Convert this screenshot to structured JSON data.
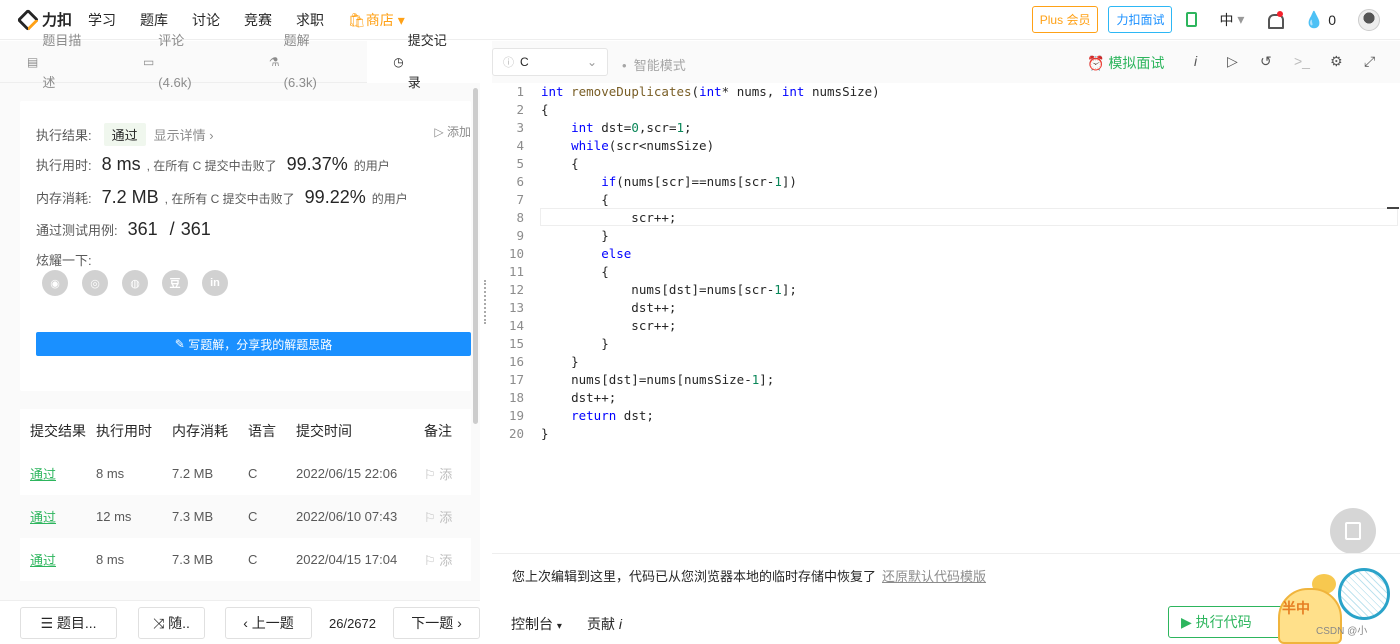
{
  "topnav": {
    "logo_text": "力扣",
    "items": [
      "学习",
      "题库",
      "讨论",
      "竞赛",
      "求职"
    ],
    "store": "商店",
    "plus": "Plus 会员",
    "interview": "力扣面试",
    "lang": "中",
    "points": "0"
  },
  "tabs": [
    {
      "label": "题目描述",
      "icon": "doc-icon"
    },
    {
      "label": "评论 (4.6k)",
      "icon": "comment-icon"
    },
    {
      "label": "题解 (6.3k)",
      "icon": "flask-icon"
    },
    {
      "label": "提交记录",
      "icon": "clock-icon"
    }
  ],
  "result": {
    "label_result": "执行结果:",
    "status": "通过",
    "show_detail": "显示详情",
    "add_note": "添加",
    "label_time": "执行用时:",
    "time_value": "8 ms",
    "time_text": ", 在所有 C 提交中击败了",
    "time_pct": "99.37%",
    "users": "的用户",
    "label_mem": "内存消耗:",
    "mem_value": "7.2 MB",
    "mem_text": ", 在所有 C 提交中击败了",
    "mem_pct": "99.22%",
    "label_cases": "通过测试用例:",
    "cases_passed": "361",
    "cases_sep": "/",
    "cases_total": "361",
    "share_label": "炫耀一下:",
    "share_icons": [
      "wechat-icon",
      "weibo-icon",
      "qq-icon",
      "douban-icon",
      "linkedin-icon"
    ],
    "share_icon_glyphs": [
      "◉",
      "◎",
      "◍",
      "豆",
      "in"
    ],
    "write_solution": "写题解，分享我的解题思路"
  },
  "submissions": {
    "headers": [
      "提交结果",
      "执行用时",
      "内存消耗",
      "语言",
      "提交时间",
      "备注"
    ],
    "rows": [
      {
        "status": "通过",
        "time": "8 ms",
        "mem": "7.2 MB",
        "lang": "C",
        "date": "2022/06/15 22:06",
        "note": "添"
      },
      {
        "status": "通过",
        "time": "12 ms",
        "mem": "7.3 MB",
        "lang": "C",
        "date": "2022/06/10 07:43",
        "note": "添"
      },
      {
        "status": "通过",
        "time": "8 ms",
        "mem": "7.3 MB",
        "lang": "C",
        "date": "2022/04/15 17:04",
        "note": "添"
      }
    ]
  },
  "bottom_left": {
    "problems": "题目...",
    "random": "随..",
    "prev": "上一题",
    "pager": "26/2672",
    "next": "下一题"
  },
  "editor": {
    "language": "C",
    "smart_mode": "智能模式",
    "mock_interview": "模拟面试",
    "code_lines": [
      "int removeDuplicates(int* nums, int numsSize)",
      "{",
      "    int dst=0,scr=1;",
      "    while(scr<numsSize)",
      "    {",
      "        if(nums[scr]==nums[scr-1])",
      "        {",
      "            scr++;",
      "        }",
      "        else",
      "        {",
      "            nums[dst]=nums[scr-1];",
      "            dst++;",
      "            scr++;",
      "        }",
      "    }",
      "    nums[dst]=nums[numsSize-1];",
      "    dst++;",
      "    return dst;",
      "}"
    ],
    "restore_msg": "您上次编辑到这里，代码已从您浏览器本地的临时存储中恢复了",
    "restore_link": "还原默认代码模版"
  },
  "bottom_right": {
    "console": "控制台",
    "contribute": "贡献",
    "run": "执行代码"
  },
  "mascot": {
    "text": "半中",
    "tag": "CSDN @小"
  },
  "colors": {
    "accent_green": "#2db55d",
    "brand_orange": "#ffa116",
    "blue": "#1a90ff"
  }
}
